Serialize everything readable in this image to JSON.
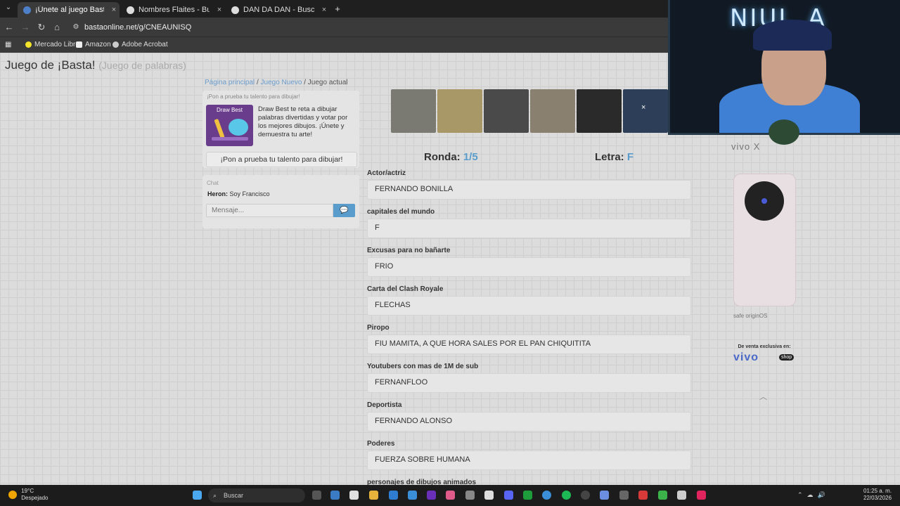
{
  "browser": {
    "tabs": [
      {
        "title": "¡Únete al juego Basta!",
        "active": true,
        "color": "#4e7fc9"
      },
      {
        "title": "Nombres Flaites - Buscar con Go",
        "active": false,
        "color": "#dddddd"
      },
      {
        "title": "DAN DA DAN - Buscar con Googl",
        "active": false,
        "color": "#dddddd"
      }
    ],
    "close_glyph": "×",
    "new_tab_glyph": "+",
    "url": "bastaonline.net/g/CNEAUNISQ",
    "bookmarks": [
      {
        "label": "Mercado Libre",
        "color": "#f3e32a"
      },
      {
        "label": "Amazon",
        "color": "#eeeeee"
      },
      {
        "label": "Adobe Acrobat",
        "color": "#cccccc"
      }
    ]
  },
  "site": {
    "title": "Juego de ¡Basta!",
    "subtitle": "(Juego de palabras)",
    "breadcrumb": [
      "Página principal",
      "Juego Nuevo",
      "Juego actual"
    ]
  },
  "promo": {
    "heading": "¡Pon a prueba tu talento para dibujar!",
    "image_label": "Draw Best",
    "text": "Draw Best te reta a dibujar palabras divertidas y votar por los mejores dibujos. ¡Únete y demuestra tu arte!",
    "button": "¡Pon a prueba tu talento para dibujar!"
  },
  "chat": {
    "heading": "Chat",
    "message_user": "Heron:",
    "message_text": " Soy Francisco",
    "placeholder": "Mensaje..."
  },
  "game": {
    "round_label": "Ronda:",
    "round_value": "1/5",
    "letter_label": "Letra:",
    "letter_value": "F",
    "fields": [
      {
        "label": "Actor/actriz",
        "value": "FERNANDO BONILLA"
      },
      {
        "label": "capitales del mundo",
        "value": "F"
      },
      {
        "label": "Excusas para no bañarte",
        "value": "FRIO"
      },
      {
        "label": "Carta del Clash Royale",
        "value": "FLECHAS"
      },
      {
        "label": "Piropo",
        "value": "FIU MAMITA, A QUE HORA SALES POR EL PAN CHIQUITITA"
      },
      {
        "label": "Youtubers con mas de 1M de sub",
        "value": "FERNANFLOO"
      },
      {
        "label": "Deportista",
        "value": "FERNANDO ALONSO"
      },
      {
        "label": "Poderes",
        "value": "FUERZA SOBRE HUMANA"
      },
      {
        "label": "personajes de dibujos animados",
        "value": ""
      }
    ]
  },
  "ad": {
    "brand": "vivo X",
    "sale_text": "De venta exclusiva en:",
    "sale_brand": "vivo",
    "shop_badge": "shop",
    "badges": "safe   originOS",
    "close_glyph": "×",
    "up_glyph": "︿"
  },
  "webcam": {
    "neon_text": "NIUL_A"
  },
  "taskbar": {
    "temperature": "19°C",
    "weather": "Despejado",
    "search": "Buscar",
    "time": "01:25 a. m.",
    "date": "22/03/2026"
  }
}
